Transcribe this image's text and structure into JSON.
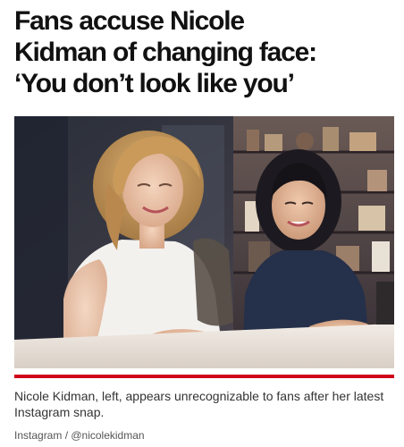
{
  "article": {
    "headline_lines": [
      "Fans accuse Nicole",
      "Kidman of changing face:",
      "‘You don’t look like you’"
    ],
    "caption": "Nicole Kidman, left, appears unrecognizable to fans after her latest Instagram snap.",
    "credit": "Instagram / @nicolekidman"
  },
  "colors": {
    "accent_rule": "#d0021b"
  },
  "photo": {
    "depicts": "photo-two-women-leaning-on-table"
  }
}
